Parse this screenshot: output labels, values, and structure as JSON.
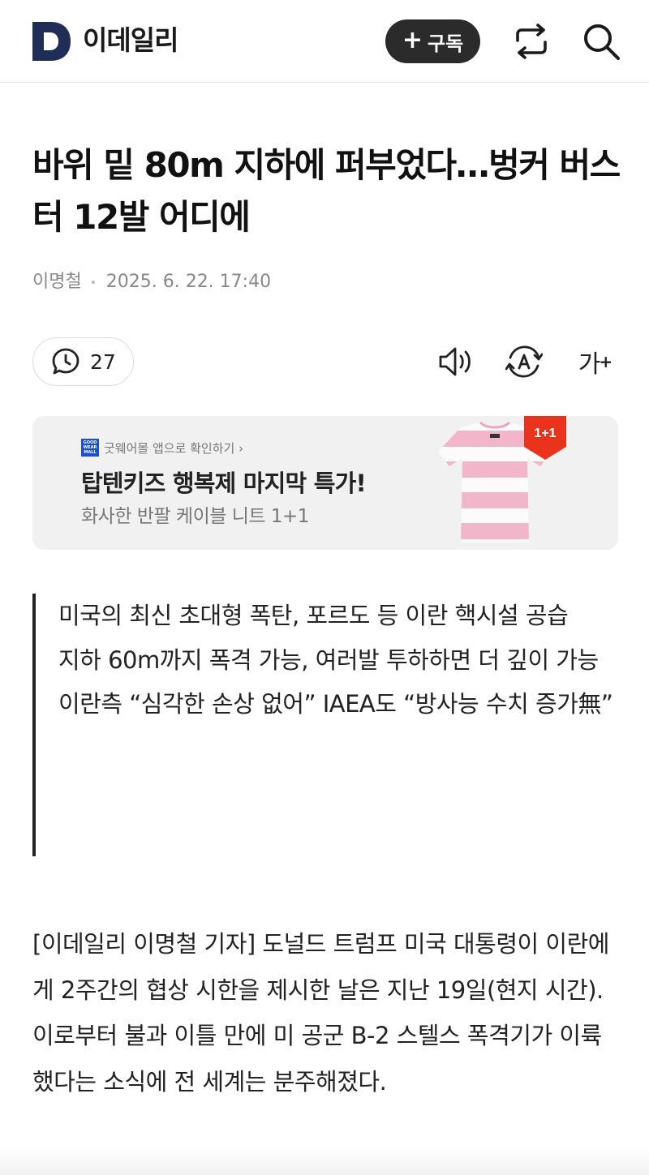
{
  "header": {
    "logo_letter": "D",
    "brand": "이데일리",
    "subscribe_plus": "+",
    "subscribe_label": "구독",
    "share_icon": "share-icon",
    "search_icon": "search-icon"
  },
  "article": {
    "title": "바위 밑 80m 지하에 퍼부었다…벙커 버스터 12발 어디에",
    "author": "이명철",
    "datetime": "2025. 6. 22. 17:40"
  },
  "toolbar": {
    "comment_count": "27",
    "font_size_label": "가",
    "font_size_plus": "+"
  },
  "ad": {
    "source_logo": "GOOD WEAR MALL",
    "source": "굿웨어몰 앱으로 확인하기 ›",
    "headline": "탑텐키즈 행복제 마지막 특가!",
    "subtitle": "화사한 반팔 케이블 니트 1+1",
    "badge": "1+1"
  },
  "summary": [
    "미국의 최신 초대형 폭탄, 포르도 등 이란 핵시설 공습",
    "지하 60m까지 폭격 가능, 여러발 투하하면 더 깊이 가능",
    "이란측 “심각한 손상 없어” IAEA도 “방사능 수치 증가無”"
  ],
  "body": "[이데일리 이명철 기자] 도널드 트럼프 미국 대통령이 이란에게 2주간의 협상 시한을 제시한 날은 지난 19일(현지 시간). 이로부터 불과 이틀 만에 미 공군 B-2 스텔스 폭격기가 이륙했다는 소식에 전 세계는 분주해졌다.",
  "colors": {
    "subscribe_bg": "#2b2b2b",
    "logo_navy": "#1f2d57",
    "ad_bg": "#f1f1f1",
    "badge_red": "#e8341c",
    "product_pink": "#f2b6cb"
  }
}
